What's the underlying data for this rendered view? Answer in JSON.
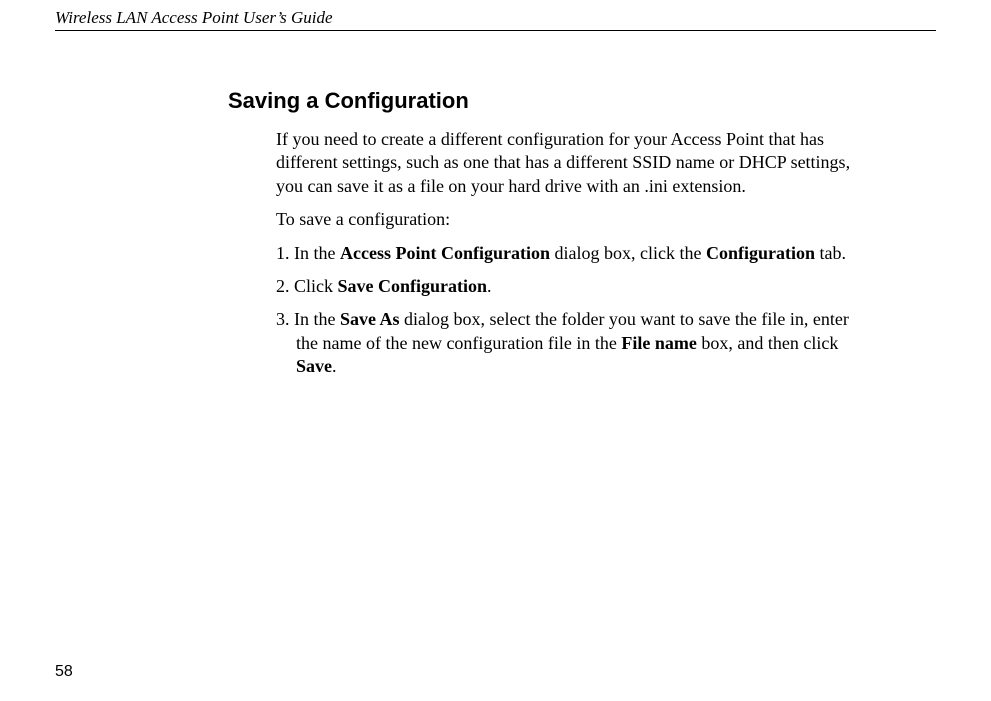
{
  "header": {
    "title": "Wireless LAN Access Point User’s Guide"
  },
  "page": {
    "number": "58"
  },
  "section": {
    "heading": "Saving a Configuration",
    "intro": "If you need to create a different configuration for your Access Point that has different settings, such as one that has a different SSID name or DHCP settings, you can save it as a file on your hard drive with an .ini extension.",
    "lead": "To save a configuration:",
    "steps": {
      "s1": {
        "p1": "1. In the ",
        "b1": "Access Point Configuration",
        "p2": " dialog box, click the ",
        "b2": "Configuration",
        "p3": " tab."
      },
      "s2": {
        "p1": "2. Click ",
        "b1": "Save Configuration",
        "p2": "."
      },
      "s3": {
        "p1": "3. In the ",
        "b1": "Save As",
        "p2": " dialog box, select the folder you want to save the file in, enter the name of the new configuration file in the ",
        "b2": "File name",
        "p3": " box, and then click ",
        "b3": "Save",
        "p4": "."
      }
    }
  }
}
